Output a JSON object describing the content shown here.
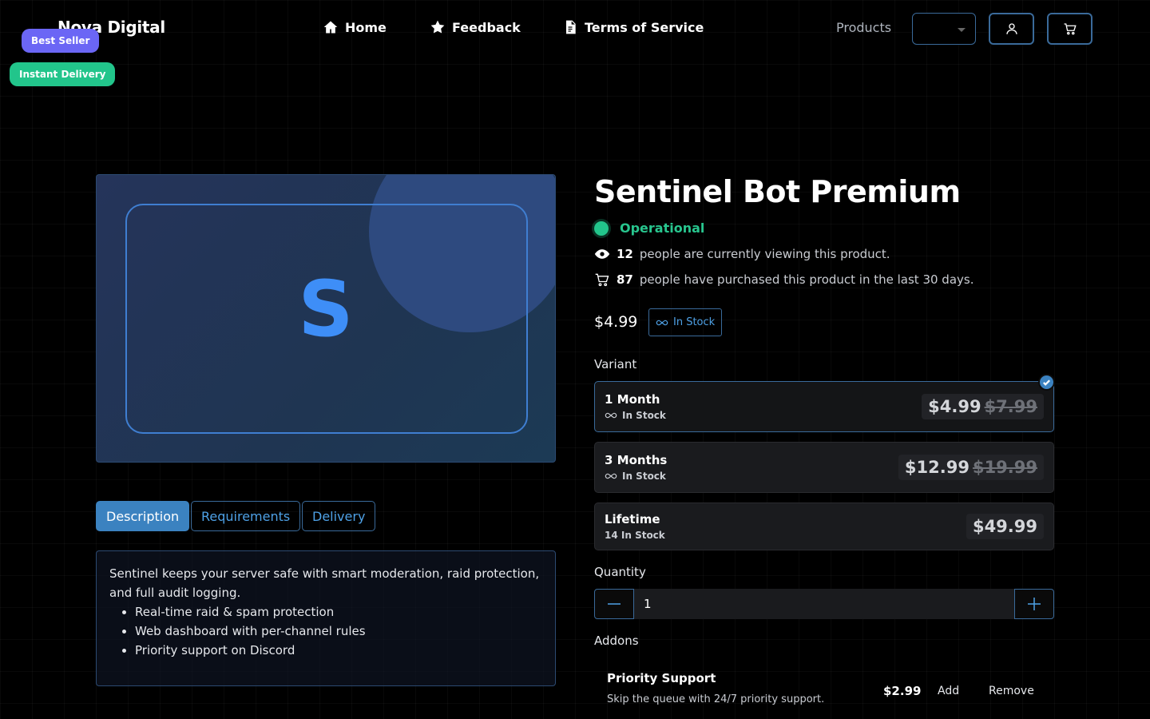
{
  "header": {
    "brand": "Nova Digital",
    "badges": {
      "best_seller": "Best Seller",
      "instant_delivery": "Instant Delivery"
    },
    "nav": {
      "home": "Home",
      "feedback": "Feedback",
      "terms": "Terms of Service"
    },
    "products_label": "Products",
    "currency_select_value": ""
  },
  "product": {
    "image_letter": "S",
    "title": "Sentinel Bot Premium",
    "status": "Operational",
    "viewing_count": "12",
    "viewing_text": "people are currently viewing this product.",
    "purchased_count": "87",
    "purchased_text": "people have purchased this product in the last 30 days.",
    "price": "$4.99",
    "stock": "In Stock"
  },
  "tabs": {
    "description": "Description",
    "requirements": "Requirements",
    "delivery": "Delivery"
  },
  "description": {
    "intro": "Sentinel keeps your server safe with smart moderation, raid protection, and full audit logging.",
    "features": [
      "Real-time raid & spam protection",
      "Web dashboard with per-channel rules",
      "Priority support on Discord"
    ]
  },
  "variant_section": {
    "label": "Variant",
    "items": [
      {
        "name": "1 Month",
        "stock": "In Stock",
        "price": "$4.99",
        "old_price": "$7.99",
        "selected": true
      },
      {
        "name": "3 Months",
        "stock": "In Stock",
        "price": "$12.99",
        "old_price": "$19.99",
        "selected": false
      },
      {
        "name": "Lifetime",
        "stock": "14 In Stock",
        "price": "$49.99",
        "old_price": "",
        "selected": false
      }
    ]
  },
  "quantity": {
    "label": "Quantity",
    "value": "1"
  },
  "addons": {
    "label": "Addons",
    "items": [
      {
        "name": "Priority Support",
        "description": "Skip the queue with 24/7 priority support.",
        "price": "$2.99",
        "add_label": "Add",
        "remove_label": "Remove"
      }
    ]
  },
  "colors": {
    "accent": "#3b82c0",
    "success": "#22c58b",
    "badge_best": "#6b66f5"
  }
}
